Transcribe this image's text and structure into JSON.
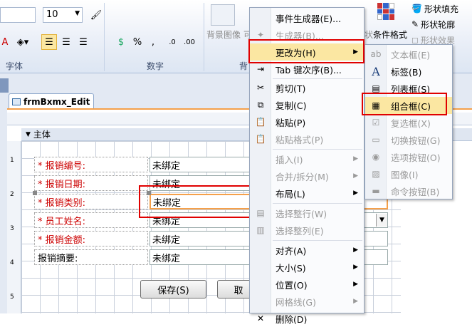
{
  "ribbon": {
    "font_size_value": "10",
    "group_font": "字体",
    "group_number": "数字",
    "group_partial": "背",
    "bg_image_label": "背景图像",
    "conditional_format_label": "条件格式",
    "shape_fill": "形状填充",
    "shape_outline": "形状轮廓",
    "shape_effect": "形状效果",
    "percent": "%",
    "comma": ","
  },
  "form_tab": "frmBxmx_Edit",
  "section_title": "主体",
  "fields": [
    {
      "label": "* 报销编号:",
      "value": "未绑定",
      "required": true
    },
    {
      "label": "* 报销日期:",
      "value": "未绑定",
      "required": true
    },
    {
      "label": "* 报销类别:",
      "value": "未绑定",
      "required": true
    },
    {
      "label": "* 员工姓名:",
      "value": "未绑定",
      "required": true
    },
    {
      "label": "* 报销金额:",
      "value": "未绑定",
      "required": true
    },
    {
      "label": "报销摘要:",
      "value": "未绑定",
      "required": false
    }
  ],
  "buttons": {
    "save": "保存(S)",
    "cancel_partial": "取"
  },
  "context_menu": [
    {
      "label": "事件生成器(E)...",
      "icon": "event-icon",
      "disabled": false,
      "submenu": false
    },
    {
      "label": "生成器(B)...",
      "icon": "builder-icon",
      "disabled": true,
      "submenu": false
    },
    {
      "label": "更改为(H)",
      "icon": "",
      "disabled": false,
      "submenu": true,
      "highlight": true
    },
    {
      "label": "Tab 键次序(B)...",
      "icon": "tab-order-icon",
      "disabled": false,
      "submenu": false
    },
    {
      "label": "剪切(T)",
      "icon": "scissors-icon",
      "disabled": false,
      "submenu": false
    },
    {
      "label": "复制(C)",
      "icon": "copy-icon",
      "disabled": false,
      "submenu": false
    },
    {
      "label": "粘贴(P)",
      "icon": "paste-icon",
      "disabled": false,
      "submenu": false
    },
    {
      "label": "粘贴格式(P)",
      "icon": "paste-format-icon",
      "disabled": true,
      "submenu": false
    },
    {
      "label": "插入(I)",
      "icon": "",
      "disabled": true,
      "submenu": true
    },
    {
      "label": "合并/拆分(M)",
      "icon": "",
      "disabled": true,
      "submenu": true
    },
    {
      "label": "布局(L)",
      "icon": "",
      "disabled": false,
      "submenu": true
    },
    {
      "label": "选择整行(W)",
      "icon": "select-row-icon",
      "disabled": true,
      "submenu": false
    },
    {
      "label": "选择整列(E)",
      "icon": "select-column-icon",
      "disabled": true,
      "submenu": false
    },
    {
      "label": "对齐(A)",
      "icon": "",
      "disabled": false,
      "submenu": true
    },
    {
      "label": "大小(S)",
      "icon": "",
      "disabled": false,
      "submenu": true
    },
    {
      "label": "位置(O)",
      "icon": "",
      "disabled": false,
      "submenu": true
    },
    {
      "label": "网格线(G)",
      "icon": "",
      "disabled": true,
      "submenu": true
    },
    {
      "label": "删除(D)",
      "icon": "delete-icon",
      "disabled": false,
      "submenu": false
    }
  ],
  "submenu": [
    {
      "label": "文本框(E)",
      "icon": "textbox-icon",
      "disabled": true
    },
    {
      "label": "标签(B)",
      "icon": "label-a-icon",
      "disabled": false
    },
    {
      "label": "列表框(S)",
      "icon": "listbox-icon",
      "disabled": false
    },
    {
      "label": "组合框(C)",
      "icon": "combobox-icon",
      "disabled": false,
      "highlight": true
    },
    {
      "label": "复选框(X)",
      "icon": "checkbox-icon",
      "disabled": true
    },
    {
      "label": "切换按钮(G)",
      "icon": "toggle-icon",
      "disabled": true
    },
    {
      "label": "选项按钮(O)",
      "icon": "option-icon",
      "disabled": true
    },
    {
      "label": "图像(I)",
      "icon": "image-icon",
      "disabled": true
    },
    {
      "label": "命令按钮(B)",
      "icon": "command-button-icon",
      "disabled": true
    }
  ]
}
